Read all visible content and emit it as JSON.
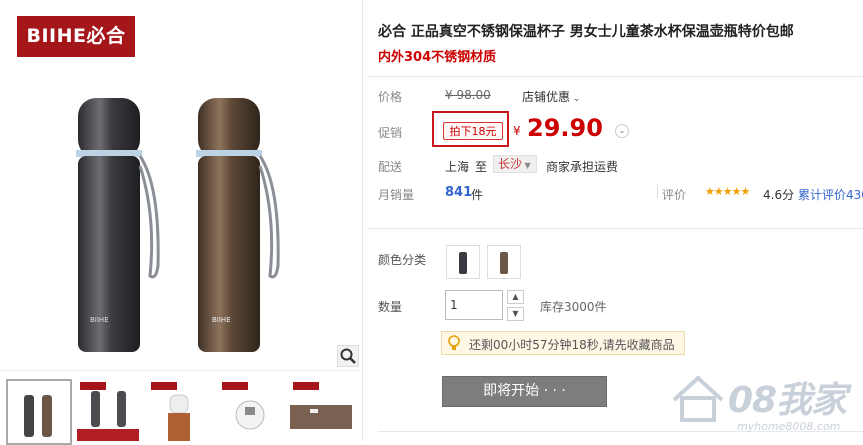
{
  "brand": {
    "logo_text": "BIIHE必合"
  },
  "product": {
    "title": "必合 正品真空不锈钢保温杯子 男女士儿童茶水杯保温壶瓶特价包邮",
    "subtitle": "内外304不锈钢材质"
  },
  "price": {
    "label": "价格",
    "original": "¥ 98.00",
    "shop_discount": "店铺优惠"
  },
  "promo": {
    "label": "促销",
    "tag": "拍下18元",
    "currency": "¥",
    "amount": "29.90"
  },
  "delivery": {
    "label": "配送",
    "from": "上海",
    "to_word": "至",
    "city": "长沙",
    "fee_note": "商家承担运费"
  },
  "sales": {
    "label": "月销量",
    "count": "841",
    "unit": "件",
    "rating_label": "评价",
    "score": "4.6分",
    "total_reviews": "累计评价430"
  },
  "color": {
    "label": "颜色分类"
  },
  "quantity": {
    "label": "数量",
    "value": "1",
    "stock": "库存3000件"
  },
  "notice": {
    "text": "还剩00小时57分钟18秒,请先收藏商品"
  },
  "actions": {
    "coming_soon": "即将开始 · · ·"
  },
  "watermark": {
    "text": "08我家",
    "url": "myhome8008.com"
  },
  "icons": {
    "zoom": "magnifier-icon",
    "bulb": "lightbulb-icon",
    "chevron": "chevron-down-icon",
    "home": "house-icon"
  },
  "colors": {
    "accent_red": "#c00",
    "brand_red": "#a5161a",
    "link_blue": "#36c",
    "button_gray": "#7d7d7d"
  }
}
